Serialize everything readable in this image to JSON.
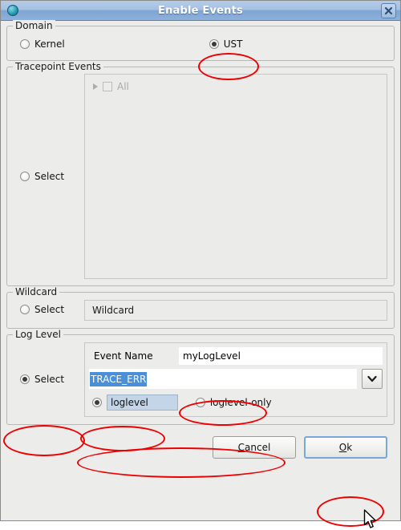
{
  "window": {
    "title": "Enable Events",
    "icon": "app-globe-icon",
    "close_label": "x"
  },
  "domain": {
    "group_title": "Domain",
    "options": [
      {
        "label": "Kernel",
        "selected": false
      },
      {
        "label": "UST",
        "selected": true
      }
    ]
  },
  "tracepoint": {
    "group_title": "Tracepoint Events",
    "select_label": "Select",
    "select_checked": false,
    "tree": {
      "expander": "triangle-right-icon",
      "checkbox_checked": false,
      "label": "All",
      "disabled": true
    }
  },
  "wildcard": {
    "group_title": "Wildcard",
    "select_label": "Select",
    "select_checked": false,
    "field_value": "Wildcard"
  },
  "loglevel": {
    "group_title": "Log Level",
    "select_label": "Select",
    "select_checked": true,
    "event_name_label": "Event Name",
    "event_name_value": "myLogLevel",
    "combo_value": "TRACE_ERR",
    "combo_selected": true,
    "combo_icon": "chevron-down-icon",
    "modes": [
      {
        "label": "loglevel",
        "selected": true
      },
      {
        "label": "loglevel-only",
        "selected": false
      }
    ]
  },
  "buttons": {
    "cancel": {
      "label": "Cancel",
      "mnemonic": "C",
      "focused": false
    },
    "ok": {
      "label": "Ok",
      "mnemonic": "O",
      "focused": true
    }
  },
  "colors": {
    "titlebar_blue": "#8eb1da",
    "selection_blue": "#4a90d9",
    "annotation_red": "#ee0000",
    "dialog_grey": "#ececeb",
    "focus_border": "#7aa7d8"
  }
}
